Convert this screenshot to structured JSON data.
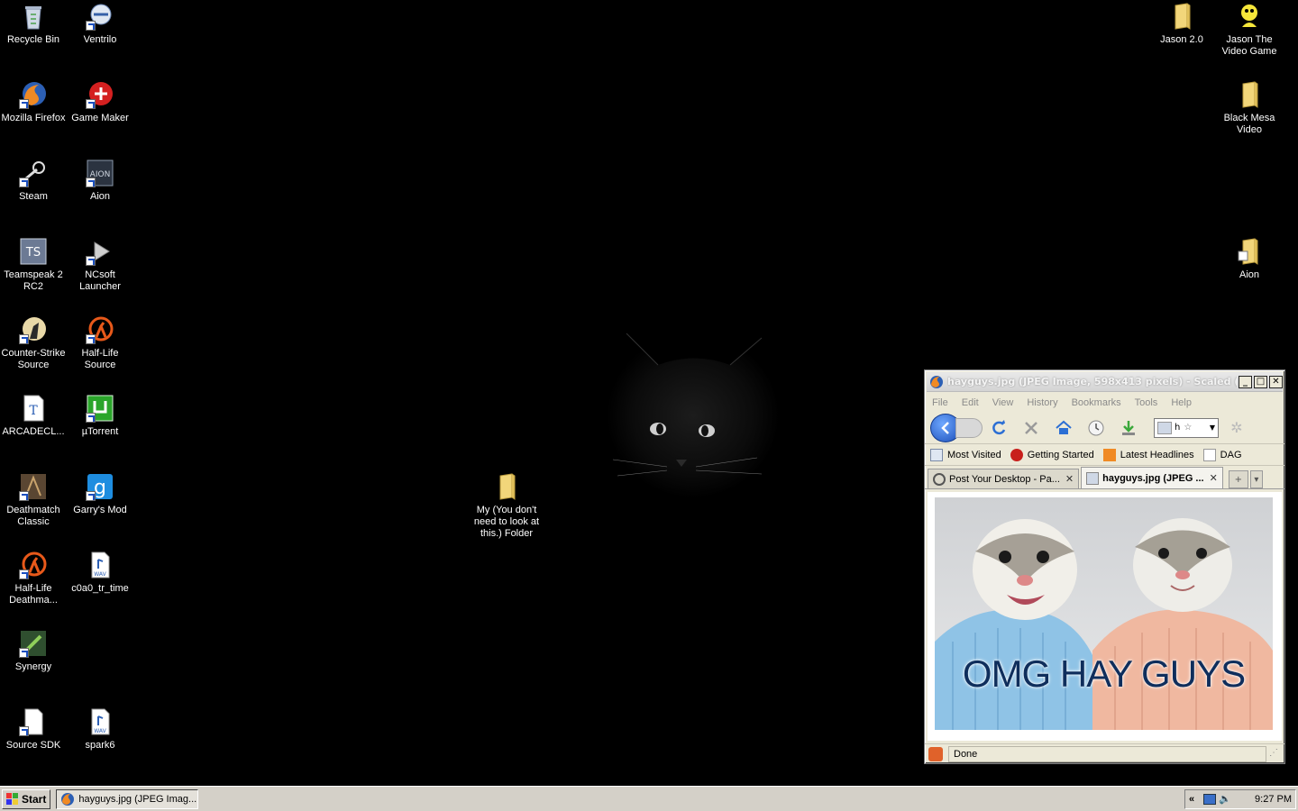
{
  "desktop": {
    "icons_left": [
      {
        "label": "Recycle Bin",
        "icon": "recycle-bin-icon"
      },
      {
        "label": "Ventrilo",
        "icon": "ventrilo-icon"
      },
      {
        "label": "Mozilla Firefox",
        "icon": "firefox-icon"
      },
      {
        "label": "Game Maker",
        "icon": "game-maker-icon"
      },
      {
        "label": "Steam",
        "icon": "steam-icon"
      },
      {
        "label": "Aion",
        "icon": "aion-icon"
      },
      {
        "label": "Teamspeak 2 RC2",
        "icon": "teamspeak-icon"
      },
      {
        "label": "NCsoft Launcher",
        "icon": "ncsoft-icon"
      },
      {
        "label": "Counter-Strike Source",
        "icon": "counter-strike-icon"
      },
      {
        "label": "Half-Life Source",
        "icon": "half-life-icon"
      },
      {
        "label": "ARCADECL...",
        "icon": "font-file-icon"
      },
      {
        "label": "µTorrent",
        "icon": "utorrent-icon"
      },
      {
        "label": "Deathmatch Classic",
        "icon": "deathmatch-icon"
      },
      {
        "label": "Garry's Mod",
        "icon": "garrys-mod-icon"
      },
      {
        "label": "Half-Life Deathma...",
        "icon": "half-life-icon"
      },
      {
        "label": "c0a0_tr_time",
        "icon": "wav-file-icon"
      },
      {
        "label": "Synergy",
        "icon": "synergy-icon"
      },
      {
        "label": "Source SDK",
        "icon": "source-sdk-icon"
      },
      {
        "label": "spark6",
        "icon": "wav-file-icon"
      }
    ],
    "icons_right": [
      {
        "label": "Jason 2.0",
        "icon": "folder-icon"
      },
      {
        "label": "Jason The Video Game",
        "icon": "game-icon"
      },
      {
        "label": "Black Mesa Video",
        "icon": "folder-icon"
      },
      {
        "label": "Aion",
        "icon": "folder-icon"
      }
    ],
    "center_folder": {
      "label": "My (You don't need to look at this.) Folder",
      "icon": "folder-icon"
    }
  },
  "window": {
    "title": "hayguys.jpg (JPEG Image, 598x413 pixels) - Scaled (62",
    "menu": [
      "File",
      "Edit",
      "View",
      "History",
      "Bookmarks",
      "Tools",
      "Help"
    ],
    "bookmarks": [
      "Most Visited",
      "Getting Started",
      "Latest Headlines",
      "DAG"
    ],
    "tabs": [
      {
        "label": "Post Your Desktop - Pa...",
        "active": false
      },
      {
        "label": "hayguys.jpg (JPEG ...",
        "active": true
      }
    ],
    "image_caption": "OMG HAY GUYS",
    "status": "Done",
    "url_prefix": "h"
  },
  "taskbar": {
    "start": "Start",
    "task": "hayguys.jpg (JPEG Imag...",
    "tray_arrow": "«",
    "clock": "9:27 PM"
  }
}
